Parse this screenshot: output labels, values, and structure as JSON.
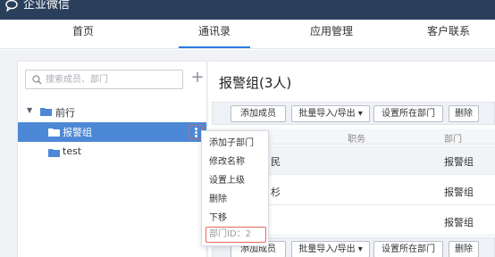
{
  "app": {
    "brand": "企业微信",
    "brand_color": "#2a3f5c",
    "accent": "#2a7ae2"
  },
  "nav": {
    "items": [
      {
        "label": "首页",
        "active": false
      },
      {
        "label": "通讯录",
        "active": true
      },
      {
        "label": "应用管理",
        "active": false
      },
      {
        "label": "客户联系",
        "active": false
      }
    ]
  },
  "search": {
    "placeholder": "搜索成员、部门",
    "value": ""
  },
  "add_icon": "plus-icon",
  "tree": {
    "root": {
      "label": "前行",
      "expanded": true
    },
    "children": [
      {
        "label": "报警组",
        "selected": true
      },
      {
        "label": "test",
        "selected": false
      }
    ]
  },
  "context_menu": {
    "items": [
      "添加子部门",
      "修改名称",
      "设置上级",
      "删除",
      "下移"
    ],
    "dept_id": "部门ID：2"
  },
  "main": {
    "title": "报警组(3人)",
    "toolbar": {
      "add_member": "添加成员",
      "batch": "批量导入/导出",
      "set_dept": "设置所在部门",
      "delete": "删除"
    },
    "columns": [
      "职务",
      "部门"
    ],
    "rows": [
      {
        "name_fragment": "民",
        "position": "",
        "dept": "报警组"
      },
      {
        "name_fragment": "杉",
        "position": "",
        "dept": "报警组"
      },
      {
        "name_fragment": "",
        "position": "",
        "dept": "报警组"
      }
    ]
  }
}
